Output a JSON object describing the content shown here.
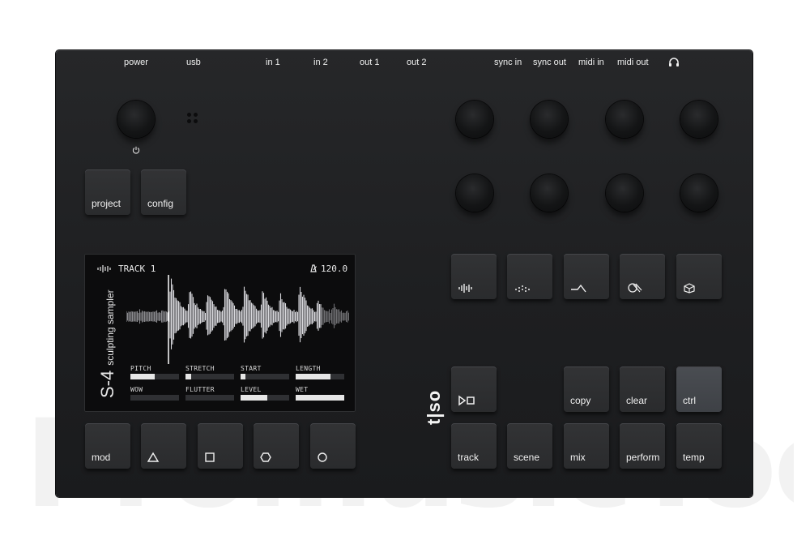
{
  "watermark": "PromusicTools",
  "ports": [
    "power",
    "usb",
    "in 1",
    "in 2",
    "out 1",
    "out 2",
    "sync in",
    "sync out",
    "midi in",
    "midi out"
  ],
  "headphone_icon": "headphones-icon",
  "power_icon": "power-icon",
  "buttons": {
    "project": "project",
    "config": "config",
    "copy": "copy",
    "clear": "clear",
    "ctrl": "ctrl",
    "mod": "mod",
    "track": "track",
    "scene": "scene",
    "mix": "mix",
    "perform": "perform",
    "temp": "temp"
  },
  "screen": {
    "track_name": "TRACK 1",
    "tempo": "120.0",
    "model": "S-4",
    "subtitle": "sculpting sampler",
    "params": [
      {
        "name": "PITCH",
        "level": 0.5
      },
      {
        "name": "STRETCH",
        "level": 0.12
      },
      {
        "name": "START",
        "level": 0.1
      },
      {
        "name": "LENGTH",
        "level": 0.72
      },
      {
        "name": "WOW",
        "level": 0.0
      },
      {
        "name": "FLUTTER",
        "level": 0.0
      },
      {
        "name": "LEVEL",
        "level": 0.55
      },
      {
        "name": "WET",
        "level": 1.0
      }
    ]
  },
  "logo": "t|so",
  "icons": {
    "sampler": "waveform-icon",
    "sequence": "dots-icon",
    "filter": "filter-icon",
    "fx": "fx-icon",
    "cube": "cube-icon",
    "play": "play-stop-icon",
    "triangle": "triangle-icon",
    "square": "square-icon",
    "hexagon": "hexagon-icon",
    "circle": "circle-icon"
  },
  "colors": {
    "body": "#1e1f21",
    "key": "#2e2f31",
    "key_lit": "#44474c",
    "screen": "#0c0c0d",
    "text": "#f0f0f0"
  }
}
